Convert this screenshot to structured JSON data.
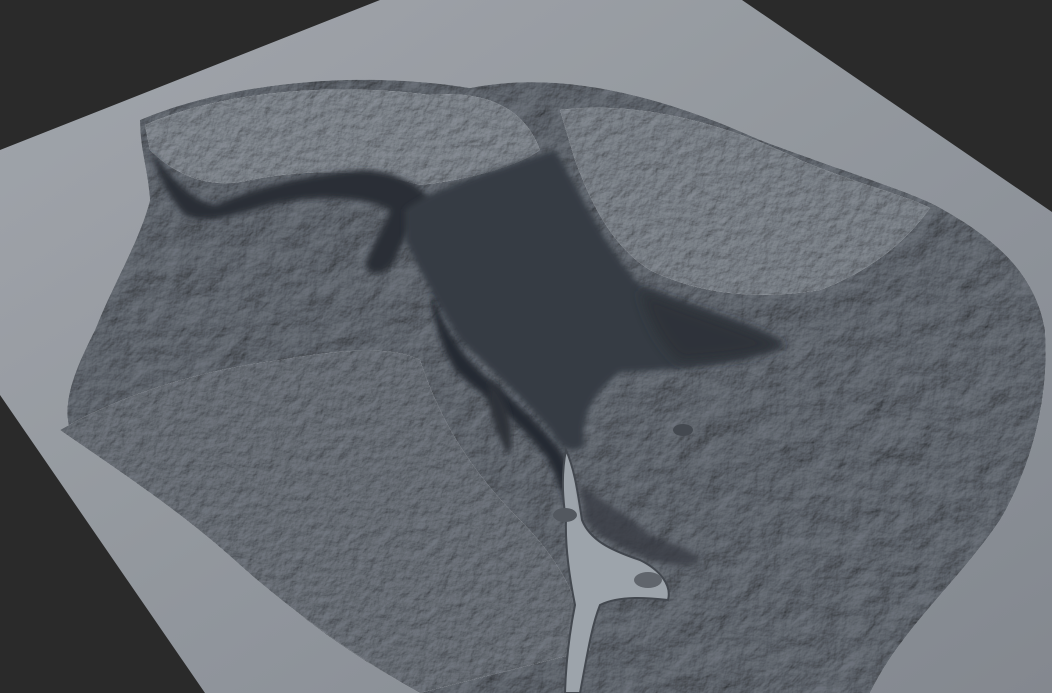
{
  "scene": {
    "subject": "terrain-heightmap-render",
    "background_color": "#2a2a2a",
    "terrain_base_color": "#8a8f96",
    "terrain_highlight_color": "#b9bec4",
    "terrain_shadow_color": "#2b3038",
    "water_color": "#9aa1a8"
  }
}
